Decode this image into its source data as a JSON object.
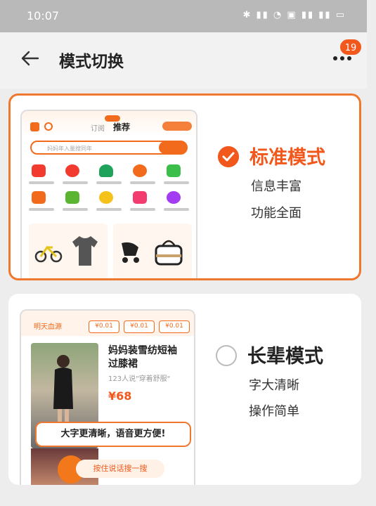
{
  "status_bar": {
    "time": "10:07",
    "indicators": "✱ ▮▮ ◔ ▣ ▮▮ ▮▮ ▭"
  },
  "header": {
    "title": "模式切换",
    "notification_count": "19"
  },
  "modes": [
    {
      "name": "标准模式",
      "desc_1": "信息丰富",
      "desc_2": "功能全面",
      "selected": true
    },
    {
      "name": "长辈模式",
      "desc_1": "字大清晰",
      "desc_2": "操作简单",
      "selected": false
    }
  ],
  "standard_preview": {
    "tab_follow": "订阅",
    "tab_recommend": "推荐",
    "search_placeholder": "妈妈年入量搜同年"
  },
  "elder_preview": {
    "section_label": "明天血源",
    "chips": [
      "¥0.01",
      "¥0.01",
      "¥0.01"
    ],
    "product_title": "妈妈装雪纺短袖过膝裙",
    "product_sub": "123人说\"穿着舒服\"",
    "price": "¥68",
    "banner": "大字更清晰，语音更方便!",
    "voice_button": "按住说话搜一搜"
  },
  "colors": {
    "accent": "#f2581b",
    "selected_border": "#f0782e"
  }
}
